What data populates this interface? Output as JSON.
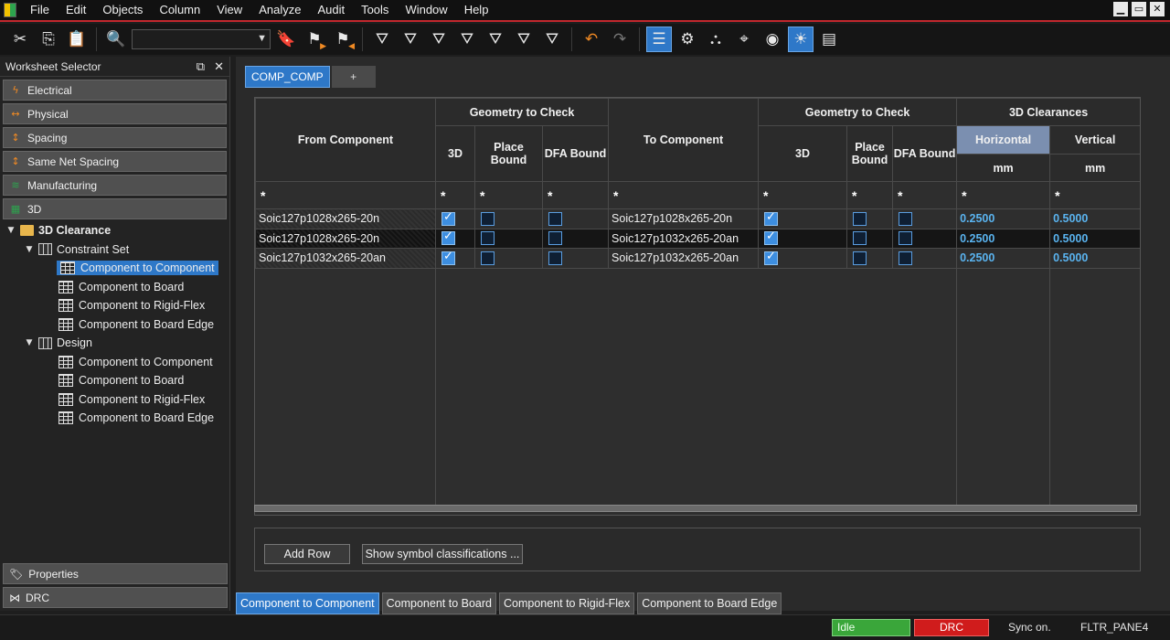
{
  "menu": [
    "File",
    "Edit",
    "Objects",
    "Column",
    "View",
    "Analyze",
    "Audit",
    "Tools",
    "Window",
    "Help"
  ],
  "window_controls": [
    "▁",
    "▭",
    "✕"
  ],
  "toolbar": {
    "combo_value": ""
  },
  "worksheet_selector": {
    "title": "Worksheet Selector",
    "categories": [
      {
        "label": "Electrical",
        "icon": "lightning-icon",
        "color": "#f08a24"
      },
      {
        "label": "Physical",
        "icon": "arrows-horizontal-icon",
        "color": "#f08a24"
      },
      {
        "label": "Spacing",
        "icon": "arrows-vertical-icon",
        "color": "#f08a24"
      },
      {
        "label": "Same Net Spacing",
        "icon": "arrows-vertical-icon",
        "color": "#f08a24"
      },
      {
        "label": "Manufacturing",
        "icon": "layers-icon",
        "color": "#2da44e"
      },
      {
        "label": "3D",
        "icon": "cube-icon",
        "color": "#2da44e"
      }
    ],
    "tree": {
      "root": "3D Clearance",
      "groups": [
        {
          "label": "Constraint Set",
          "items": [
            "Component to Component",
            "Component to Board",
            "Component to Rigid-Flex",
            "Component to Board Edge"
          ]
        },
        {
          "label": "Design",
          "items": [
            "Component to Component",
            "Component to Board",
            "Component to Rigid-Flex",
            "Component to Board Edge"
          ]
        }
      ],
      "selected": "Constraint Set / Component to Component"
    },
    "bottom_categories": [
      {
        "label": "Properties",
        "icon": "tag-icon"
      },
      {
        "label": "DRC",
        "icon": "bowtie-icon"
      }
    ]
  },
  "main": {
    "tabs": [
      {
        "label": "COMP_COMP",
        "active": true
      },
      {
        "label": "+",
        "active": false
      }
    ],
    "grid": {
      "headers": {
        "from_component": "From Component",
        "geometry_group": "Geometry to Check",
        "to_component": "To Component",
        "clearances_group": "3D Clearances",
        "col_3d": "3D",
        "col_place_bound": "Place Bound",
        "col_dfa_bound": "DFA Bound",
        "col_horizontal": "Horizontal",
        "col_vertical": "Vertical",
        "unit": "mm"
      },
      "filter_symbol": "*",
      "rows": [
        {
          "from": "Soic127p1028x265-20n",
          "from_3d": true,
          "from_place": false,
          "from_dfa": false,
          "to": "Soic127p1028x265-20n",
          "to_3d": true,
          "to_place": false,
          "to_dfa": false,
          "horizontal": "0.2500",
          "vertical": "0.5000",
          "selected": false
        },
        {
          "from": "Soic127p1028x265-20n",
          "from_3d": true,
          "from_place": false,
          "from_dfa": false,
          "to": "Soic127p1032x265-20an",
          "to_3d": true,
          "to_place": false,
          "to_dfa": false,
          "horizontal": "0.2500",
          "vertical": "0.5000",
          "selected": true
        },
        {
          "from": "Soic127p1032x265-20an",
          "from_3d": true,
          "from_place": false,
          "from_dfa": false,
          "to": "Soic127p1032x265-20an",
          "to_3d": true,
          "to_place": false,
          "to_dfa": false,
          "horizontal": "0.2500",
          "vertical": "0.5000",
          "selected": false
        }
      ]
    },
    "buttons": {
      "add_row": "Add Row",
      "show_symbol": "Show symbol classifications ..."
    },
    "sheet_tabs": [
      {
        "label": "Component to Component",
        "active": true
      },
      {
        "label": "Component to Board",
        "active": false
      },
      {
        "label": "Component to Rigid-Flex",
        "active": false
      },
      {
        "label": "Component to Board Edge",
        "active": false
      }
    ]
  },
  "status": {
    "idle": "Idle",
    "drc": "DRC",
    "sync": "Sync on.",
    "pane": "FLTR_PANE4"
  },
  "colors": {
    "accent": "#2e78c8",
    "value_text": "#5ab4f0",
    "idle_green": "#3aa63a",
    "drc_red": "#d01c1c"
  }
}
